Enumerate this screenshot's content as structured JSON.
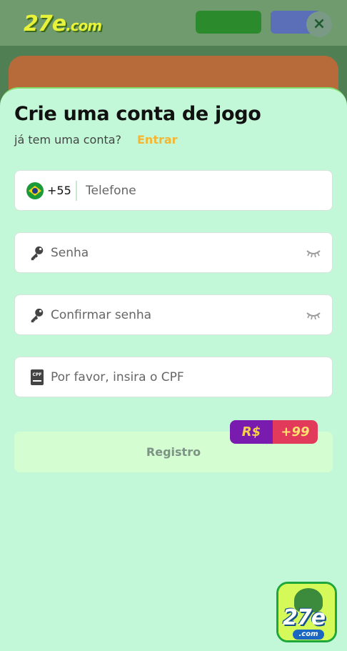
{
  "background": {
    "logo_main": "27e",
    "logo_suffix": ".com"
  },
  "modal": {
    "title": "Crie uma conta de jogo",
    "subtitle": "já tem uma conta?",
    "login_link": "Entrar",
    "close_label": "×"
  },
  "form": {
    "phone": {
      "country_code": "+55",
      "placeholder": "Telefone",
      "value": ""
    },
    "password": {
      "placeholder": "Senha",
      "value": ""
    },
    "confirm_password": {
      "placeholder": "Confirmar senha",
      "value": ""
    },
    "cpf": {
      "placeholder": "Por favor, insira o CPF",
      "value": ""
    },
    "submit_label": "Registro"
  },
  "bonus_badge": {
    "currency": "R$",
    "amount": "+99"
  },
  "app_badge": {
    "text": "27e",
    "suffix": ".com"
  },
  "colors": {
    "sheet_background": "#c2f8d8",
    "login_link": "#f3b733",
    "submit_background": "#d4fdd2",
    "bonus_left": "#7a1bb0",
    "bonus_right": "#e23a5a"
  },
  "icons": {
    "flag": "brazil-flag-icon",
    "password": "key-icon",
    "toggle_visibility": "eye-closed-icon",
    "cpf": "id-document-icon",
    "close": "close-icon"
  }
}
